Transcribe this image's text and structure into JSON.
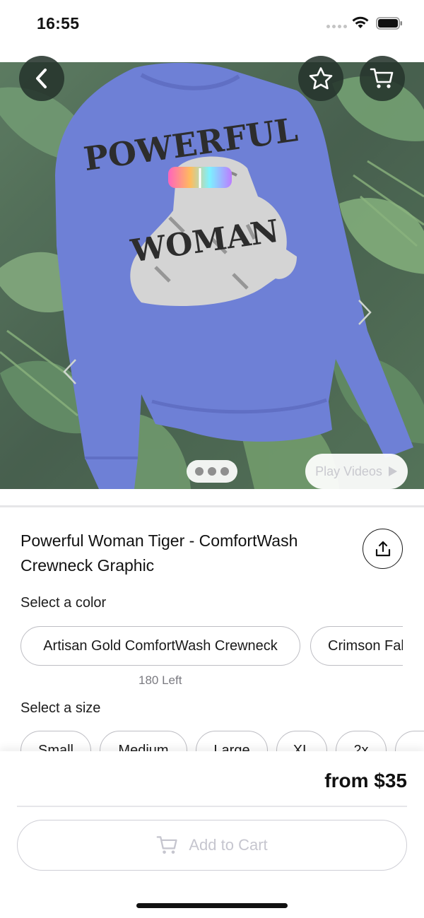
{
  "status_bar": {
    "time": "16:55"
  },
  "hero": {
    "icons": {
      "back": "chevron-left-icon",
      "favorite": "star-icon",
      "cart": "cart-icon",
      "play": "play-icon"
    },
    "play_videos_label": "Play Videos",
    "image_text": [
      "POWERFUL",
      "WOMAN"
    ],
    "colors": {
      "sweatshirt": "#5b6fd1",
      "leaves": "#3f6a45"
    }
  },
  "product": {
    "title": "Powerful Woman Tiger - ComfortWash Crewneck Graphic",
    "share_icon": "share-icon"
  },
  "color_selector": {
    "label": "Select a color",
    "options": [
      "Artisan Gold ComfortWash Crewneck",
      "Crimson Fal"
    ],
    "stock_note": "180 Left"
  },
  "size_selector": {
    "label": "Select a size",
    "options": [
      "Small",
      "Medium",
      "Large",
      "XL",
      "2x"
    ]
  },
  "purchase": {
    "price": "from $35",
    "add_to_cart_label": "Add to Cart",
    "add_to_cart_icon": "cart-icon"
  }
}
